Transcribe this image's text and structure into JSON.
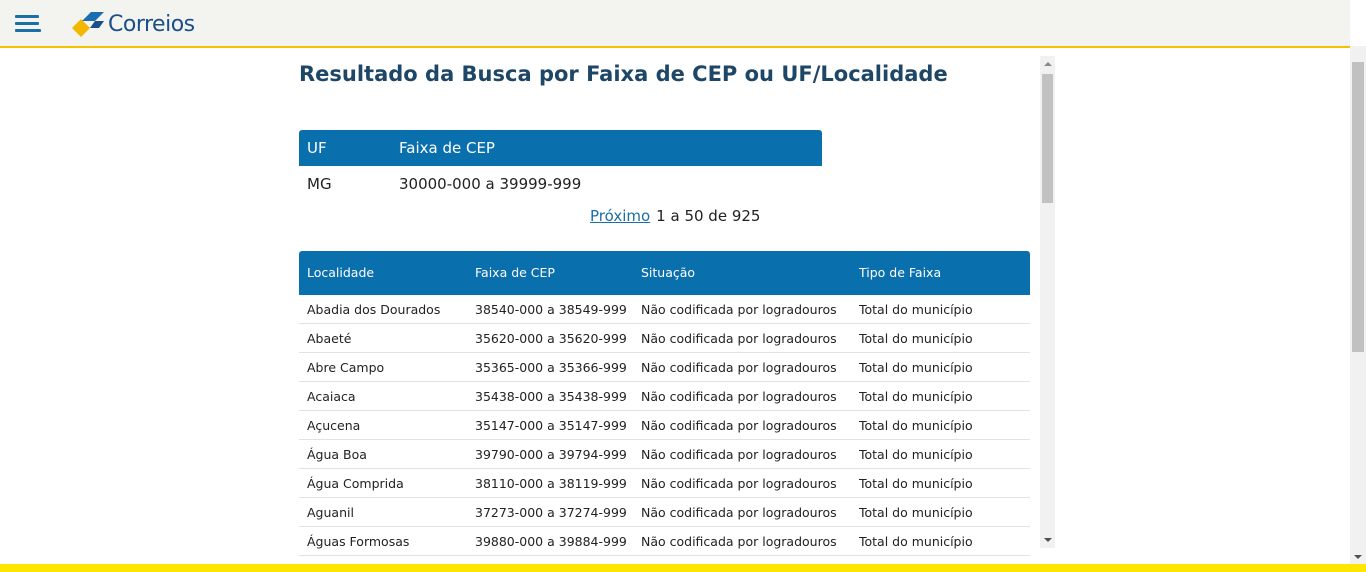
{
  "header": {
    "logo_text": "Correios",
    "menu_icon": "hamburger-menu-icon",
    "brand_colors": {
      "blue": "#1b4f8a",
      "yellow": "#f2c200",
      "accent_blue": "#0a6fad"
    }
  },
  "page_title": "Resultado da Busca por Faixa de CEP ou UF/Localidade",
  "uf_table": {
    "headers": [
      "UF",
      "Faixa de CEP"
    ],
    "row": {
      "uf": "MG",
      "faixa": "30000-000 a 39999-999"
    }
  },
  "pager": {
    "next_label": "Próximo",
    "count": "1 a 50 de 925"
  },
  "loc_table": {
    "headers": [
      "Localidade",
      "Faixa de CEP",
      "Situação",
      "Tipo de Faixa"
    ],
    "rows": [
      [
        "Abadia dos Dourados",
        "38540-000 a 38549-999",
        "Não codificada por logradouros",
        "Total do município"
      ],
      [
        "Abaeté",
        "35620-000 a 35620-999",
        "Não codificada por logradouros",
        "Total do município"
      ],
      [
        "Abre Campo",
        "35365-000 a 35366-999",
        "Não codificada por logradouros",
        "Total do município"
      ],
      [
        "Acaiaca",
        "35438-000 a 35438-999",
        "Não codificada por logradouros",
        "Total do município"
      ],
      [
        "Açucena",
        "35147-000 a 35147-999",
        "Não codificada por logradouros",
        "Total do município"
      ],
      [
        "Água Boa",
        "39790-000 a 39794-999",
        "Não codificada por logradouros",
        "Total do município"
      ],
      [
        "Água Comprida",
        "38110-000 a 38119-999",
        "Não codificada por logradouros",
        "Total do município"
      ],
      [
        "Aguanil",
        "37273-000 a 37274-999",
        "Não codificada por logradouros",
        "Total do município"
      ],
      [
        "Águas Formosas",
        "39880-000 a 39884-999",
        "Não codificada por logradouros",
        "Total do município"
      ]
    ]
  }
}
